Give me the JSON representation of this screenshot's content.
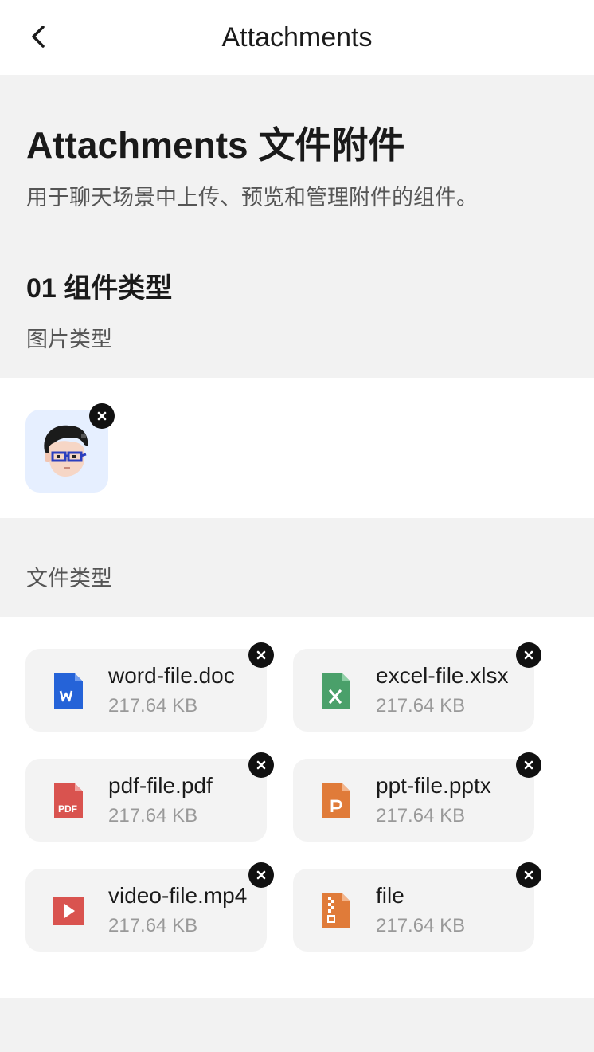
{
  "navbar": {
    "title": "Attachments"
  },
  "page": {
    "title": "Attachments 文件附件",
    "description": "用于聊天场景中上传、预览和管理附件的组件。"
  },
  "section": {
    "title": "01 组件类型",
    "image_label": "图片类型",
    "file_label": "文件类型"
  },
  "image_attachments": [
    {
      "icon": "avatar-image"
    }
  ],
  "files": [
    {
      "name": "word-file.doc",
      "size": "217.64 KB",
      "icon": "word-icon",
      "color": "#2563d8"
    },
    {
      "name": "excel-file.xlsx",
      "size": "217.64 KB",
      "icon": "excel-icon",
      "color": "#4aa06a"
    },
    {
      "name": "pdf-file.pdf",
      "size": "217.64 KB",
      "icon": "pdf-icon",
      "color": "#d9534f"
    },
    {
      "name": "ppt-file.pptx",
      "size": "217.64 KB",
      "icon": "ppt-icon",
      "color": "#e07b39"
    },
    {
      "name": "video-file.mp4",
      "size": "217.64 KB",
      "icon": "video-icon",
      "color": "#d9534f"
    },
    {
      "name": "file",
      "size": "217.64 KB",
      "icon": "zip-file-icon",
      "color": "#e07b39"
    }
  ]
}
